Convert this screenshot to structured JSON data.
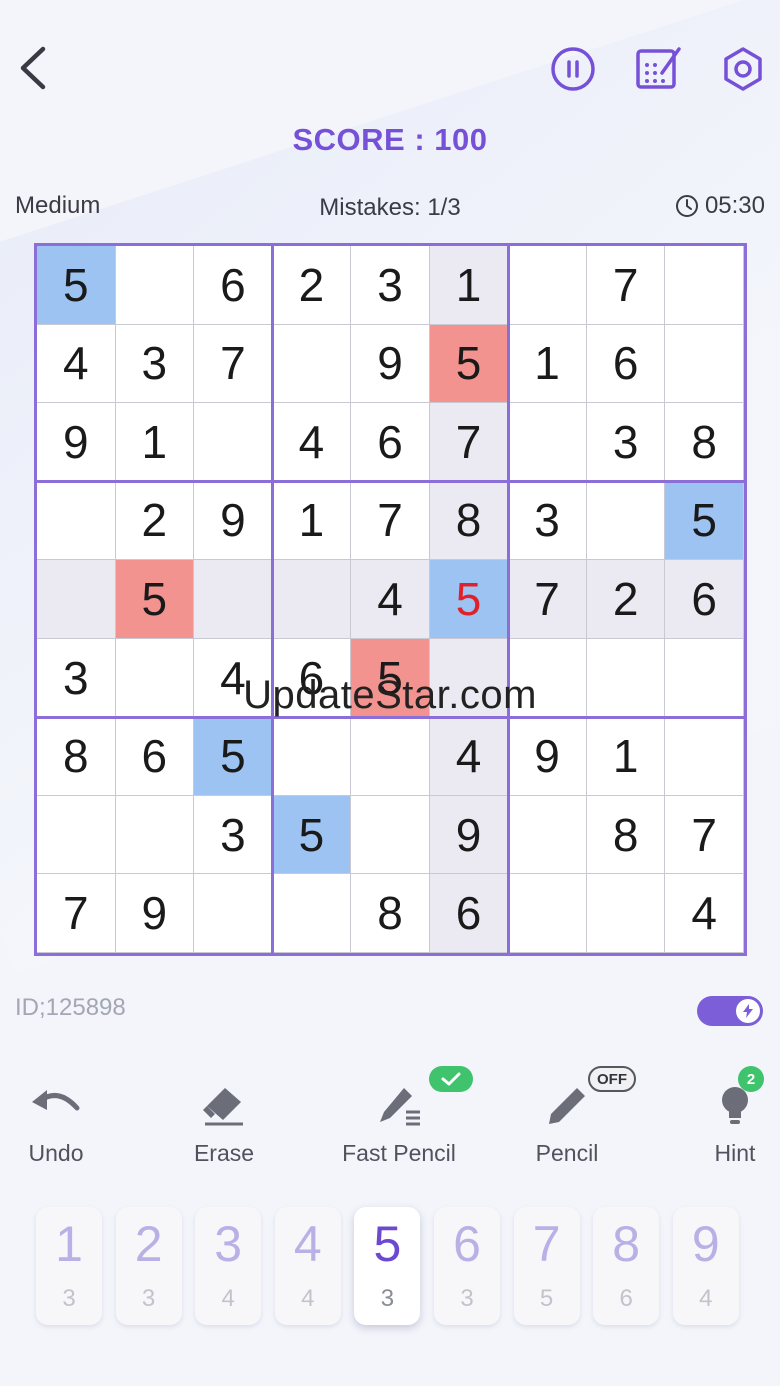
{
  "header": {
    "score_label": "SCORE : 100"
  },
  "status": {
    "difficulty": "Medium",
    "mistakes": "Mistakes: 1/3",
    "timer": "05:30"
  },
  "board": {
    "cells": [
      [
        "5",
        "",
        "6",
        "2",
        "3",
        "1",
        "",
        "7",
        ""
      ],
      [
        "4",
        "3",
        "7",
        "",
        "9",
        "5",
        "1",
        "6",
        ""
      ],
      [
        "9",
        "1",
        "",
        "4",
        "6",
        "7",
        "",
        "3",
        "8"
      ],
      [
        "",
        "2",
        "9",
        "1",
        "7",
        "8",
        "3",
        "",
        "5"
      ],
      [
        "",
        "5",
        "",
        "",
        "4",
        "5",
        "7",
        "2",
        "6"
      ],
      [
        "3",
        "",
        "4",
        "6",
        "5",
        "",
        "",
        "",
        ""
      ],
      [
        "8",
        "6",
        "5",
        "",
        "",
        "4",
        "9",
        "1",
        ""
      ],
      [
        "",
        "",
        "3",
        "5",
        "",
        "9",
        "",
        "8",
        "7"
      ],
      [
        "7",
        "9",
        "",
        "",
        "8",
        "6",
        "",
        "",
        "4"
      ]
    ],
    "selected_cell": [
      4,
      5
    ],
    "highlighted_row": 4,
    "highlighted_col": 5,
    "same_number_cells": [
      [
        0,
        0
      ],
      [
        3,
        8
      ],
      [
        4,
        5
      ],
      [
        6,
        2
      ],
      [
        7,
        3
      ]
    ],
    "conflict_cells": [
      [
        1,
        5
      ],
      [
        4,
        1
      ],
      [
        5,
        4
      ]
    ],
    "error_text_cells": [
      [
        4,
        5
      ]
    ],
    "colors": {
      "same_number": "#9cc3f2",
      "conflict": "#f3938f",
      "highlight": "#ebeaf2",
      "error_text": "#e0202a",
      "border": "#8c6ed8"
    }
  },
  "watermark": "UpdateStar.com",
  "puzzle_id": "ID;125898",
  "tools": {
    "undo": "Undo",
    "erase": "Erase",
    "fast_pencil": "Fast Pencil",
    "pencil": "Pencil",
    "hint": "Hint",
    "pencil_state": "OFF",
    "hint_count": "2"
  },
  "numpad": [
    {
      "digit": "1",
      "count": "3"
    },
    {
      "digit": "2",
      "count": "3"
    },
    {
      "digit": "3",
      "count": "4"
    },
    {
      "digit": "4",
      "count": "4"
    },
    {
      "digit": "5",
      "count": "3"
    },
    {
      "digit": "6",
      "count": "3"
    },
    {
      "digit": "7",
      "count": "5"
    },
    {
      "digit": "8",
      "count": "6"
    },
    {
      "digit": "9",
      "count": "4"
    }
  ],
  "numpad_selected": "5",
  "accent_color": "#7651d8"
}
